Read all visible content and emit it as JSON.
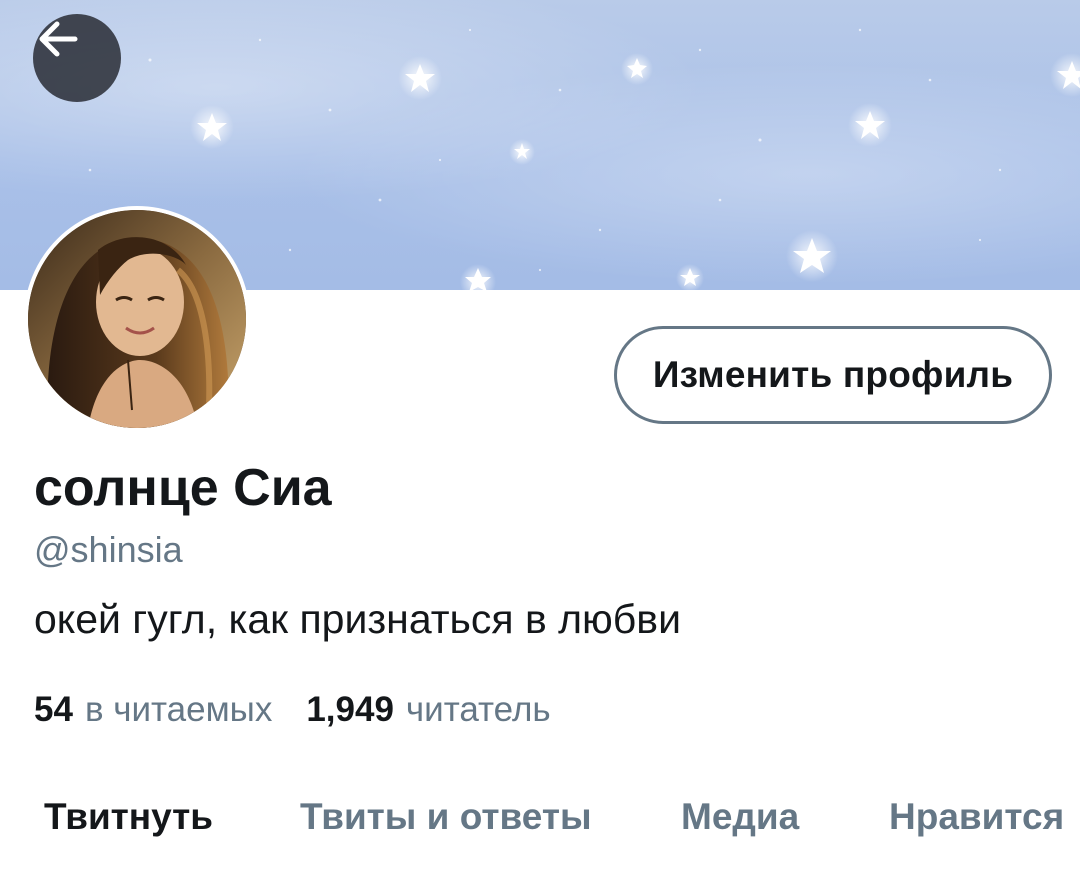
{
  "header": {
    "back_icon": "arrow-left-icon",
    "banner_colors": {
      "sky": "#a9c0e8",
      "star": "#ffffff"
    }
  },
  "profile": {
    "display_name": "солнце Сиа",
    "handle": "@shinsia",
    "bio": "окей гугл, как признаться в любви",
    "edit_button_label": "Изменить профиль"
  },
  "stats": {
    "following_count": "54",
    "following_label": "в читаемых",
    "followers_count": "1,949",
    "followers_label": "читатель"
  },
  "tabs": [
    {
      "label": "Твитнуть",
      "active": true
    },
    {
      "label": "Твиты и ответы",
      "active": false
    },
    {
      "label": "Медиа",
      "active": false
    },
    {
      "label": "Нравится",
      "active": false
    }
  ],
  "colors": {
    "text_primary": "#14171a",
    "text_secondary": "#657786",
    "border": "#657786"
  }
}
